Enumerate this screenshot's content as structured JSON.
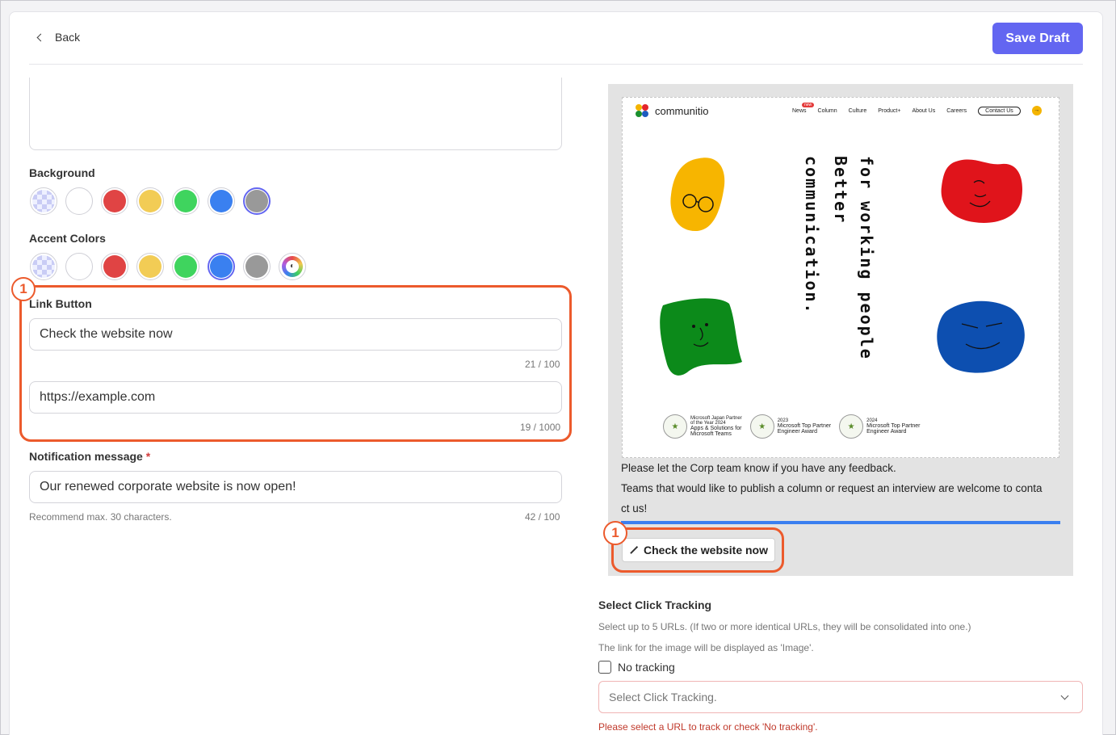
{
  "header": {
    "back_label": "Back",
    "save_label": "Save Draft"
  },
  "background": {
    "label": "Background",
    "colors": [
      "checker",
      "#ffffff",
      "#e04444",
      "#f2cc55",
      "#3fd45e",
      "#3a80f0",
      "#999999"
    ],
    "selected": "#999999"
  },
  "accent": {
    "label": "Accent Colors",
    "colors": [
      "checker",
      "#ffffff",
      "#e04444",
      "#f2cc55",
      "#3fd45e",
      "#3a80f0",
      "#999999",
      "palette"
    ],
    "selected": "#3a80f0"
  },
  "link_button": {
    "label": "Link Button",
    "text_value": "Check the website now",
    "text_counter": "21 / 100",
    "url_value": "https://example.com",
    "url_counter": "19 / 1000",
    "badge": "1"
  },
  "notification": {
    "label": "Notification message",
    "required_mark": "*",
    "value": "Our renewed corporate website is now open!",
    "hint": "Recommend max. 30 characters.",
    "counter": "42 / 100"
  },
  "preview": {
    "brand": "communitio",
    "nav": [
      "News",
      "Column",
      "Culture",
      "Product+",
      "About Us",
      "Careers"
    ],
    "nav_new_tag": "new",
    "contact": "Contact Us",
    "vertical_lines": [
      "for working people",
      "Better",
      "communication."
    ],
    "awards": [
      {
        "line1": "Microsoft Japan Partner",
        "line2": "of the Year 2024",
        "line3": "Apps & Solutions for",
        "line4": "Microsoft Teams"
      },
      {
        "line1": "2023",
        "line2": "Microsoft Top Partner",
        "line3": "Engineer Award",
        "line4": ""
      },
      {
        "line1": "2024",
        "line2": "Microsoft Top Partner",
        "line3": "Engineer Award",
        "line4": ""
      }
    ],
    "text_line1": "Please let the Corp team know if you have any feedback.",
    "text_line2": "Teams that would like to publish a column or request an interview are welcome to conta",
    "text_line3": "ct us!",
    "button_label": "Check the website now",
    "badge": "1"
  },
  "tracking": {
    "label": "Select Click Tracking",
    "hint1": "Select up to 5 URLs. (If two or more identical URLs, they will be consolidated into one.)",
    "hint2": "The link for the image will be displayed as 'Image'.",
    "no_tracking_label": "No tracking",
    "select_placeholder": "Select Click Tracking.",
    "error": "Please select a URL to track or check 'No tracking'."
  }
}
